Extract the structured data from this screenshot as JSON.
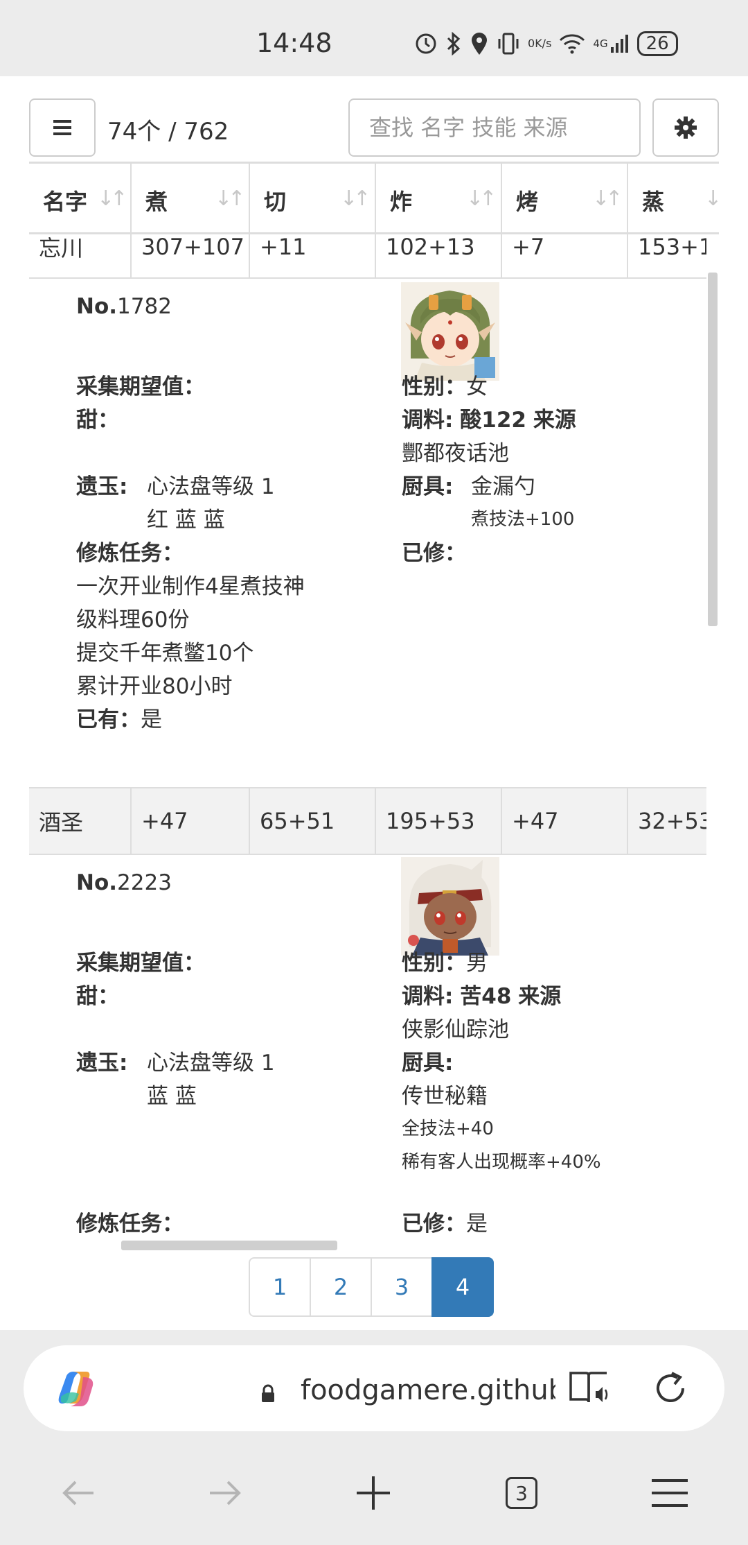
{
  "status": {
    "time": "14:48",
    "net_speed_value": "0",
    "net_speed_unit": "K/s",
    "network": "4G",
    "battery": "26"
  },
  "toolbar": {
    "count": "74个 / 762",
    "search_placeholder": "查找 名字 技能 来源"
  },
  "table": {
    "headers": [
      "名字",
      "煮",
      "切",
      "炸",
      "烤",
      "蒸"
    ],
    "rows": [
      {
        "cells": [
          "忘川",
          "307+107",
          "+11",
          "102+13",
          "+7",
          "153+1"
        ],
        "detail": {
          "no_label": "No.",
          "no": "1782",
          "gather_label": "采集期望值：",
          "sweet_label": "甜：",
          "relic_label": "遗玉:",
          "relic_line1": "心法盘等级 1",
          "relic_line2": "红 蓝 蓝",
          "quest_label": "修炼任务：",
          "quests": [
            "一次开业制作4星煮技神",
            "级料理60份",
            "提交千年煮鳖10个",
            "累计开业80小时"
          ],
          "owned_label": "已有：",
          "owned": "是",
          "gender_label": "性别：",
          "gender": "女",
          "seasoning_label": "调料:",
          "seasoning_value": "酸122",
          "source_label": "来源",
          "source": "酆都夜话池",
          "equip_label": "厨具:",
          "equip_name": "金漏勺",
          "equip_effects": [
            "煮技法+100"
          ],
          "trained_label": "已修：",
          "trained": ""
        }
      },
      {
        "cells": [
          "酒圣",
          "+47",
          "65+51",
          "195+53",
          "+47",
          "32+53"
        ],
        "detail": {
          "no_label": "No.",
          "no": "2223",
          "gather_label": "采集期望值：",
          "sweet_label": "甜：",
          "relic_label": "遗玉:",
          "relic_line1": "心法盘等级 1",
          "relic_line2": "蓝 蓝",
          "quest_label": "修炼任务：",
          "gender_label": "性别：",
          "gender": "男",
          "seasoning_label": "调料:",
          "seasoning_value": "苦48",
          "source_label": "来源",
          "source": "侠影仙踪池",
          "equip_label": "厨具:",
          "equip_name": "传世秘籍",
          "equip_effects": [
            "全技法+40",
            "稀有客人出现概率+40%"
          ],
          "trained_label": "已修：",
          "trained": "是"
        }
      }
    ]
  },
  "pagination": {
    "pages": [
      "1",
      "2",
      "3",
      "4"
    ],
    "current": "4"
  },
  "browser": {
    "url": "foodgamere.github.io",
    "tab_count": "3"
  },
  "colors": {
    "accent": "#337ab7",
    "border": "#dddddd",
    "stripe": "#f2f2f2"
  }
}
